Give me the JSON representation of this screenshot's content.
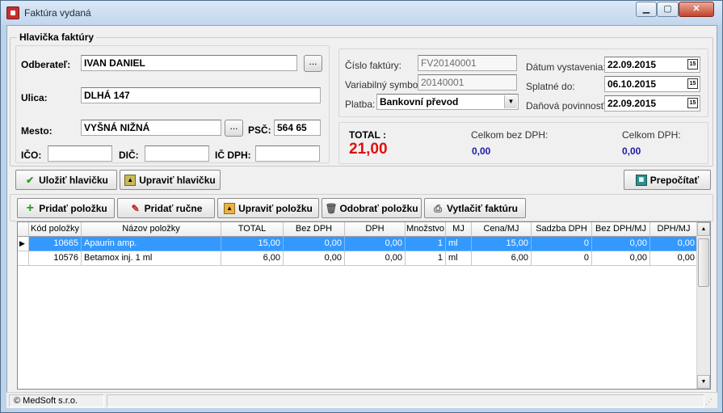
{
  "window": {
    "title": "Faktúra vydaná",
    "min_glyph": "▁",
    "max_glyph": "▢",
    "close_glyph": "✕",
    "icons": {
      "app": "app-dog-icon"
    }
  },
  "header_group": {
    "title": "Hlavička faktúry",
    "odberatel_label": "Odberateľ:",
    "odberatel_value": "IVAN DANIEL",
    "ulica_label": "Ulica:",
    "ulica_value": "DLHÁ 147",
    "mesto_label": "Mesto:",
    "mesto_value": "VYŠNÁ NIŽNÁ",
    "psc_label": "PSČ:",
    "psc_value": "564 65",
    "ico_label": "IČO:",
    "ico_value": "",
    "dic_label": "DIČ:",
    "dic_value": "",
    "icdph_label": "IČ DPH:",
    "icdph_value": "",
    "browse_label": "..."
  },
  "invoice_info": {
    "cislo_label": "Číslo faktúry:",
    "cislo_value": "FV20140001",
    "variabilny_label": "Variabilný symbol:",
    "variabilny_value": "20140001",
    "platba_label": "Platba:",
    "platba_value": "Bankovní převod",
    "vystavenie_label": "Dátum vystavenia:",
    "vystavenie_value": "22.09.2015",
    "splatne_label": "Splatné do:",
    "splatne_value": "06.10.2015",
    "danova_label": "Daňová povinnosť:",
    "danova_value": "22.09.2015",
    "cal_glyph": "15"
  },
  "totals": {
    "total_label": "TOTAL :",
    "total_value": "21,00",
    "bez_dph_label": "Celkom bez DPH:",
    "bez_dph_value": "0,00",
    "s_dph_label": "Celkom DPH:",
    "s_dph_value": "0,00",
    "colors": {
      "total": "#e01010",
      "sums": "#1a1aa8"
    }
  },
  "header_buttons": {
    "ulozit": "Uložiť hlavičku",
    "upravit": "Upraviť hlavičku",
    "prepocitat": "Prepočítať"
  },
  "item_buttons": {
    "pridat": "Pridať položku",
    "pridat_rucne": "Pridať ručne",
    "upravit": "Upraviť položku",
    "odobrat": "Odobrať položku",
    "vytlacit": "Vytlačiť faktúru"
  },
  "table": {
    "columns": [
      "Kód položky",
      "Názov položky",
      "TOTAL",
      "Bez DPH",
      "DPH",
      "Množstvo",
      "MJ",
      "Cena/MJ",
      "Sadzba DPH",
      "Bez DPH/MJ",
      "DPH/MJ"
    ],
    "rows": [
      [
        "10665",
        "Apaurin amp.",
        "15,00",
        "0,00",
        "0,00",
        "1",
        "ml",
        "15,00",
        "0",
        "0,00",
        "0,00"
      ],
      [
        "10576",
        "Betamox inj. 1 ml",
        "6,00",
        "0,00",
        "0,00",
        "1",
        "ml",
        "6,00",
        "0",
        "0,00",
        "0,00"
      ]
    ],
    "selected_row_indicator": "▶"
  },
  "statusbar": {
    "company": "© MedSoft s.r.o."
  }
}
